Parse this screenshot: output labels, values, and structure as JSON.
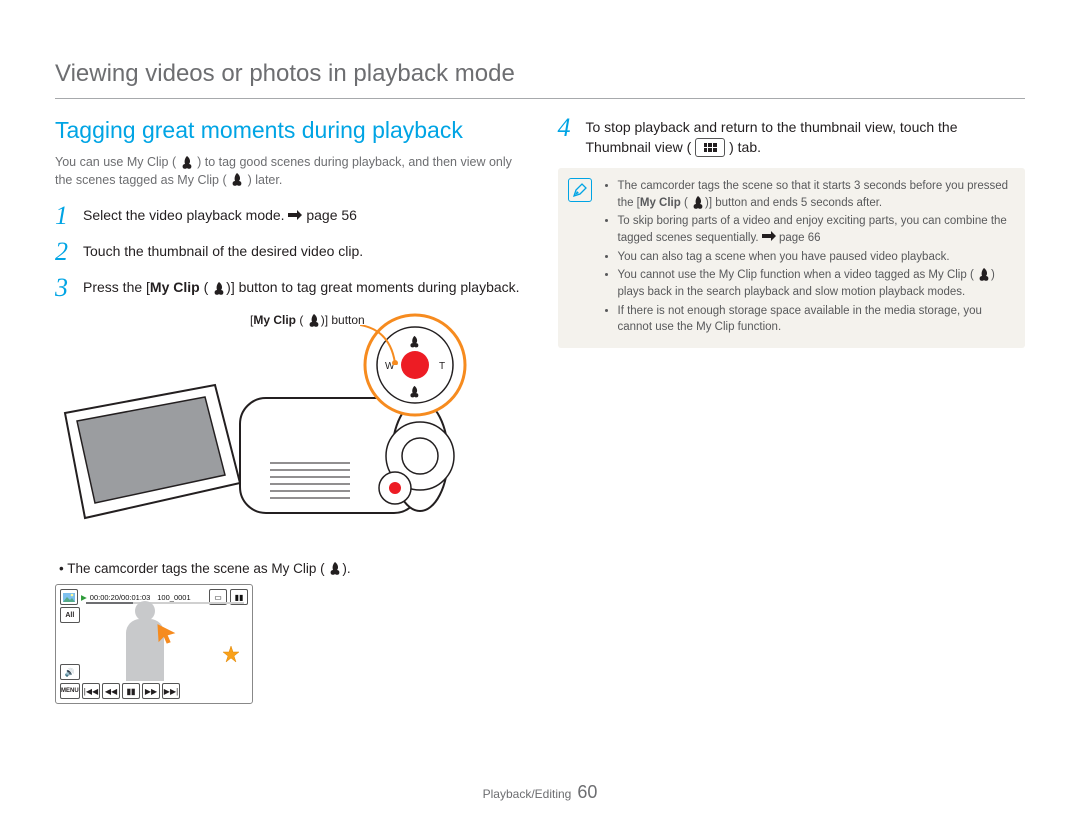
{
  "header": {
    "title": "Viewing videos or photos in playback mode"
  },
  "section": {
    "title": "Tagging great moments during playback",
    "intro_a": "You can use My Clip (",
    "intro_b": ") to tag good scenes during playback, and then view only the scenes tagged as My Clip (",
    "intro_c": ") later."
  },
  "steps": {
    "1": {
      "num": "1",
      "text_a": "Select the video playback mode. ",
      "pageref": "page 56"
    },
    "2": {
      "num": "2",
      "text": "Touch the thumbnail of the desired video clip."
    },
    "3": {
      "num": "3",
      "strong": "My Clip",
      "text_a": "Press the [",
      "text_b": " (",
      "text_c": ")] button to tag great moments during playback."
    },
    "4": {
      "num": "4",
      "text_a": "To stop playback and return to the thumbnail view, touch the Thumbnail view (",
      "text_b": ") tab."
    }
  },
  "callout": {
    "strong": "My Clip",
    "text_a": "[",
    "text_b": " (",
    "text_c": ")] button"
  },
  "sub_bullet": {
    "text_a": "The camcorder tags the scene as My Clip (",
    "text_b": ")."
  },
  "note": {
    "items": [
      {
        "a": "The camcorder tags the scene so that it starts 3 seconds before you pressed the [",
        "strong": "My Clip",
        "b": " (",
        "c": ")] button and ends 5 seconds after."
      },
      {
        "a": "To skip boring parts of a video and enjoy exciting parts, you can combine the tagged scenes sequentially. ",
        "pageref": "page 66"
      },
      {
        "a": "You can also tag a scene when you have paused video playback."
      },
      {
        "a": "You cannot use the My Clip function when a video tagged as My Clip (",
        "b": ") plays back in the search playback and slow motion playback modes."
      },
      {
        "a": "If there is not enough storage space available in the media storage, you cannot use the My Clip function."
      }
    ]
  },
  "screen": {
    "timecode": "00:00:20/00:01:03",
    "filename": "100_0001",
    "labels": {
      "all": "All",
      "menu": "MENU"
    }
  },
  "footer": {
    "section": "Playback/Editing",
    "page": "60"
  },
  "icons": {
    "myclip": "myclip-icon",
    "pageref": "pageref-arrow",
    "thumbview": "thumbnail-view-icon",
    "note": "note-pencil-icon"
  }
}
